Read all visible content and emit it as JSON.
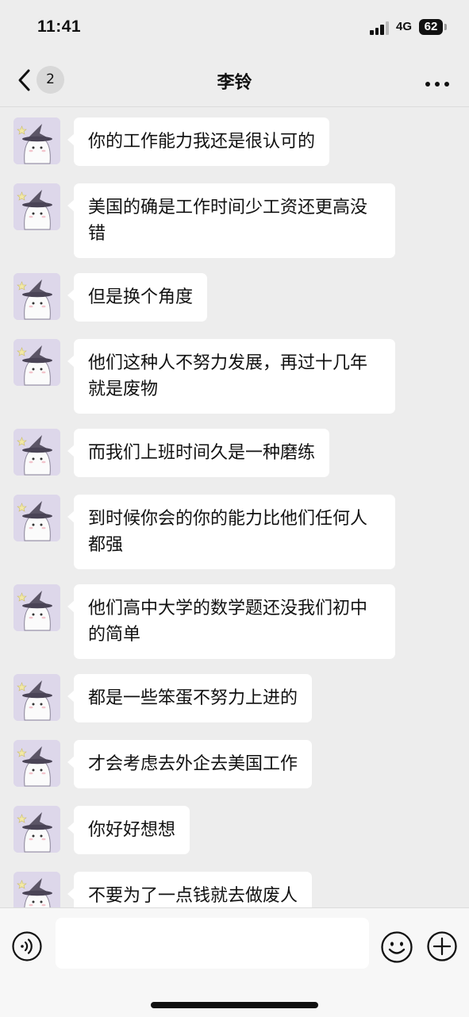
{
  "status_bar": {
    "time": "11:41",
    "network": "4G",
    "battery": "62"
  },
  "nav": {
    "back_badge": "2",
    "title": "李铃",
    "more_icon": "more-dots-icon"
  },
  "messages": [
    {
      "text": "你的工作能力我还是很认可的"
    },
    {
      "text": "美国的确是工作时间少工资还更高没错"
    },
    {
      "text": "但是换个角度"
    },
    {
      "text": "他们这种人不努力发展，再过十几年就是废物"
    },
    {
      "text": "而我们上班时间久是一种磨练"
    },
    {
      "text": "到时候你会的你的能力比他们任何人都强"
    },
    {
      "text": "他们高中大学的数学题还没我们初中的简单"
    },
    {
      "text": "都是一些笨蛋不努力上进的"
    },
    {
      "text": "才会考虑去外企去美国工作"
    },
    {
      "text": "你好好想想"
    },
    {
      "text": "不要为了一点钱就去做废人"
    }
  ],
  "input_bar": {
    "placeholder": "",
    "icons": [
      "voice-icon",
      "emoji-icon",
      "plus-icon"
    ]
  },
  "colors": {
    "background": "#ededed",
    "bubble": "#ffffff",
    "avatar_bg": "#ddd7ea",
    "accent_text": "#111111"
  }
}
